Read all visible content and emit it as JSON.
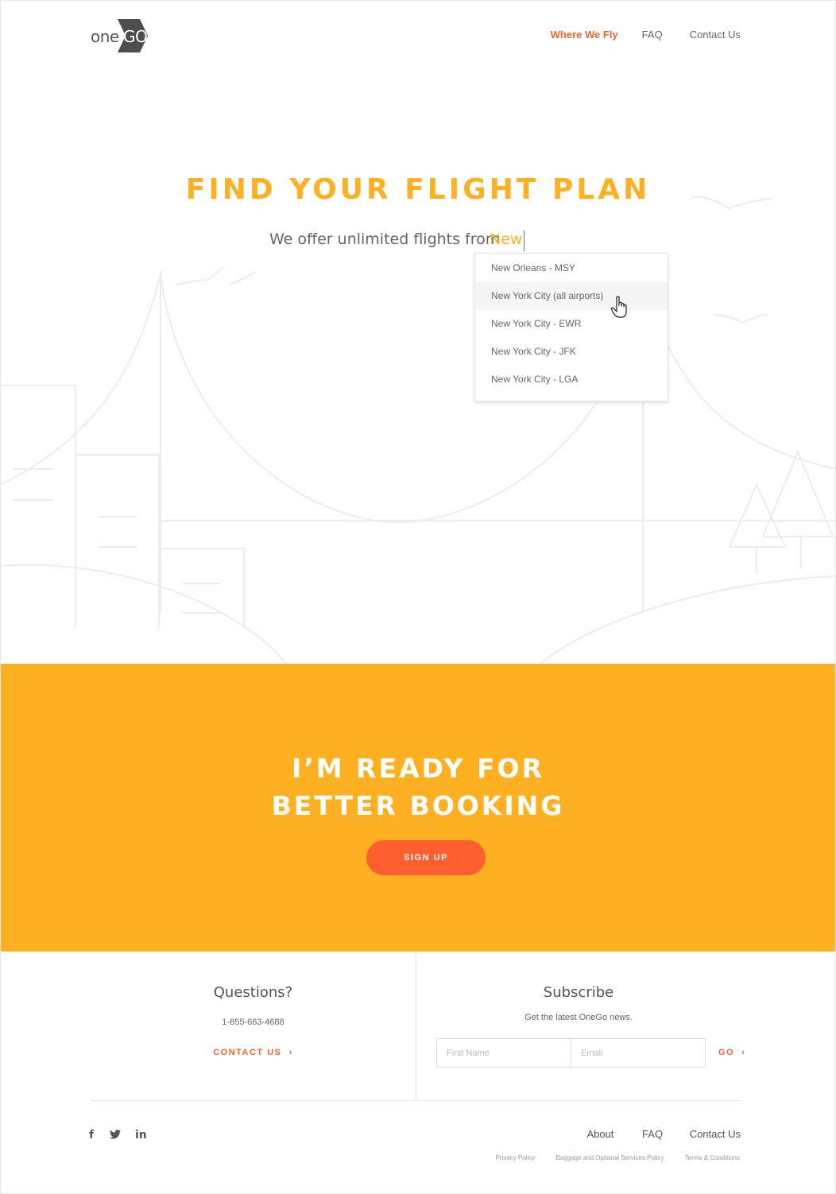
{
  "header": {
    "logo_text_left": "one",
    "logo_text_right": "GO",
    "nav": [
      "Where We Fly",
      "FAQ",
      "Contact Us"
    ],
    "active_nav_color": "#ff5f2e"
  },
  "hero": {
    "title": "FIND YOUR FLIGHT PLAN",
    "subtitle": "We offer unlimited flights from",
    "input_value": "New",
    "suggestions": [
      "New Orleans - MSY",
      "New York City (all airports)",
      "New York City - EWR",
      "New York City - JFK",
      "New York City - LGA"
    ],
    "hovered_suggestion": "New York City (all airports)",
    "accent_color": "#fdb022"
  },
  "cta": {
    "title_line1": "I’M READY FOR",
    "title_line2": "BETTER BOOKING",
    "button_label": "SIGN UP",
    "background_color": "#fdb122",
    "button_color": "#ff5f2e"
  },
  "footer": {
    "questions_title": "Questions?",
    "phone": "1-855-663-4688",
    "contact_label": "CONTACT US",
    "subscribe_title": "Subscribe",
    "subscribe_sub": "Get the latest OneGo news.",
    "first_name_placeholder": "First Name",
    "email_placeholder": "Email",
    "go_label": "GO",
    "social_icons": [
      "facebook-icon",
      "twitter-icon",
      "linkedin-icon"
    ],
    "links": [
      "About",
      "FAQ",
      "Contact Us"
    ],
    "legal": [
      "Privacy Policy",
      "Baggage and Optional Services Policy",
      "Terms & Conditions"
    ]
  }
}
